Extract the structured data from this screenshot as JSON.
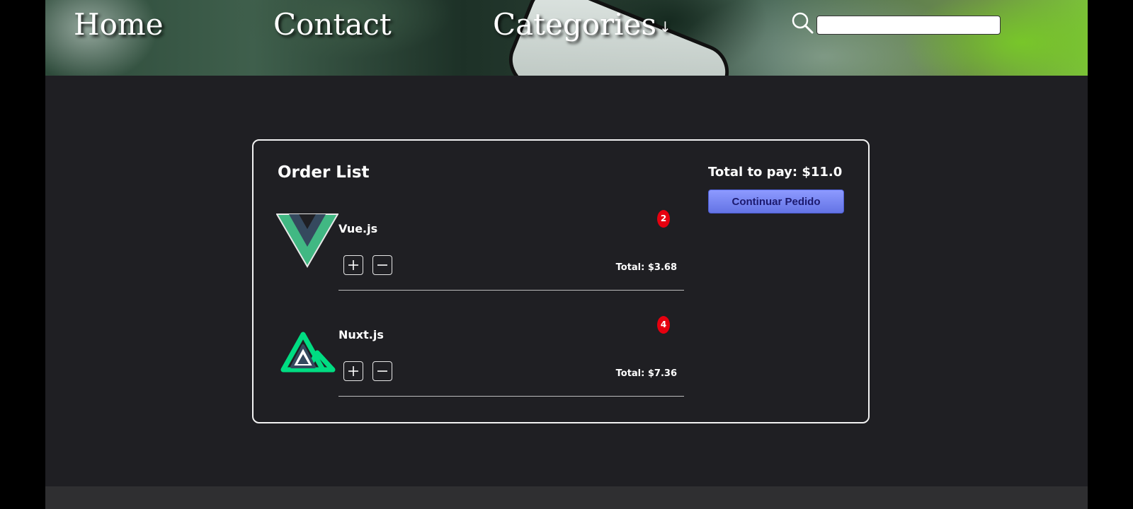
{
  "nav": {
    "home": "Home",
    "contact": "Contact",
    "categories": "Categories",
    "categories_arrow": "↓"
  },
  "search": {
    "placeholder": "",
    "value": ""
  },
  "order": {
    "title": "Order List",
    "total_to_pay": "Total to pay: $11.0",
    "continue_label": "Continuar Pedido",
    "items": [
      {
        "name": "Vue.js",
        "quantity": "2",
        "total": "Total: $3.68",
        "logo": "vue-logo"
      },
      {
        "name": "Nuxt.js",
        "quantity": "4",
        "total": "Total: $7.36",
        "logo": "nuxt-logo"
      }
    ]
  },
  "colors": {
    "background": "#1f1f23",
    "badge": "#e6000f",
    "button": "#6474e5",
    "vue_green": "#41b883",
    "vue_dark": "#35495e",
    "nuxt_green": "#00dc82"
  }
}
